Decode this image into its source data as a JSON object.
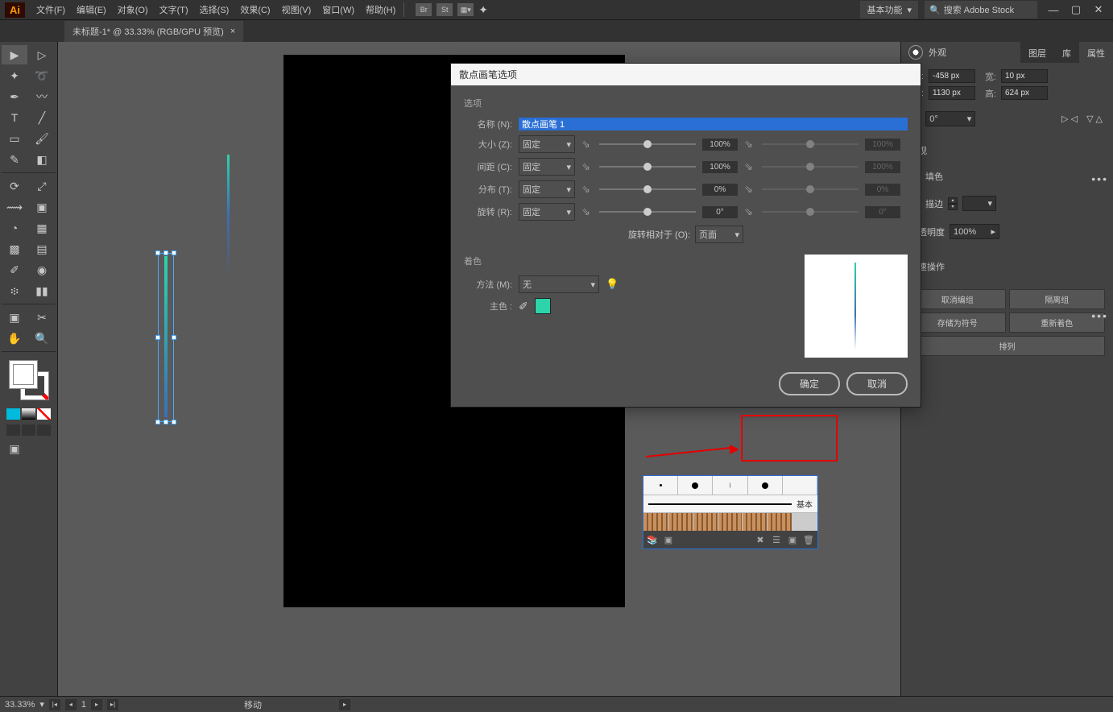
{
  "app": {
    "logo": "Ai"
  },
  "menu": [
    "文件(F)",
    "编辑(E)",
    "对象(O)",
    "文字(T)",
    "选择(S)",
    "效果(C)",
    "视图(V)",
    "窗口(W)",
    "帮助(H)"
  ],
  "titlebar_icons": [
    "Br",
    "St"
  ],
  "workspace": "基本功能",
  "search_placeholder": "搜索 Adobe Stock",
  "doc_tab": "未标题-1* @ 33.33% (RGB/GPU 预览)",
  "panel_tabs_top": [
    "外观"
  ],
  "panel_tabs": [
    "图层",
    "库",
    "属性"
  ],
  "transform": {
    "x_lbl": "X:",
    "y_lbl": "Y:",
    "w_lbl": "宽:",
    "h_lbl": "高:",
    "x": "-458 px",
    "y": "1130 px",
    "w": "10 px",
    "h": "624 px",
    "angle_lbl": "⊿:",
    "angle": "0°"
  },
  "appearance": {
    "title": "外观",
    "fill": "填色",
    "stroke": "描边",
    "opacity_lbl": "不透明度",
    "opacity": "100%"
  },
  "quick": {
    "title": "快速操作",
    "ungroup": "取消编组",
    "isolate": "隔离组",
    "save_symbol": "存储为符号",
    "recolor": "重新着色",
    "arrange": "排列"
  },
  "status": {
    "zoom": "33.33%",
    "page": "1",
    "tool": "移动"
  },
  "dialog": {
    "title": "散点画笔选项",
    "sec_options": "选项",
    "name_lbl": "名称 (N):",
    "name_val": "散点画笔 1",
    "size_lbl": "大小 (Z):",
    "size_mode": "固定",
    "size_val": "100%",
    "size_val2": "100%",
    "spacing_lbl": "间距 (C):",
    "spacing_mode": "固定",
    "spacing_val": "100%",
    "spacing_val2": "100%",
    "scatter_lbl": "分布 (T):",
    "scatter_mode": "固定",
    "scatter_val": "0%",
    "scatter_val2": "0%",
    "rotation_lbl": "旋转 (R):",
    "rotation_mode": "固定",
    "rotation_val": "0°",
    "rotation_val2": "0°",
    "rot_rel_lbl": "旋转相对于 (O):",
    "rot_rel_val": "页面",
    "sec_color": "着色",
    "method_lbl": "方法 (M):",
    "method_val": "无",
    "keycolor_lbl": "主色 :",
    "ok": "确定",
    "cancel": "取消"
  },
  "brushes": {
    "basic": "基本"
  }
}
